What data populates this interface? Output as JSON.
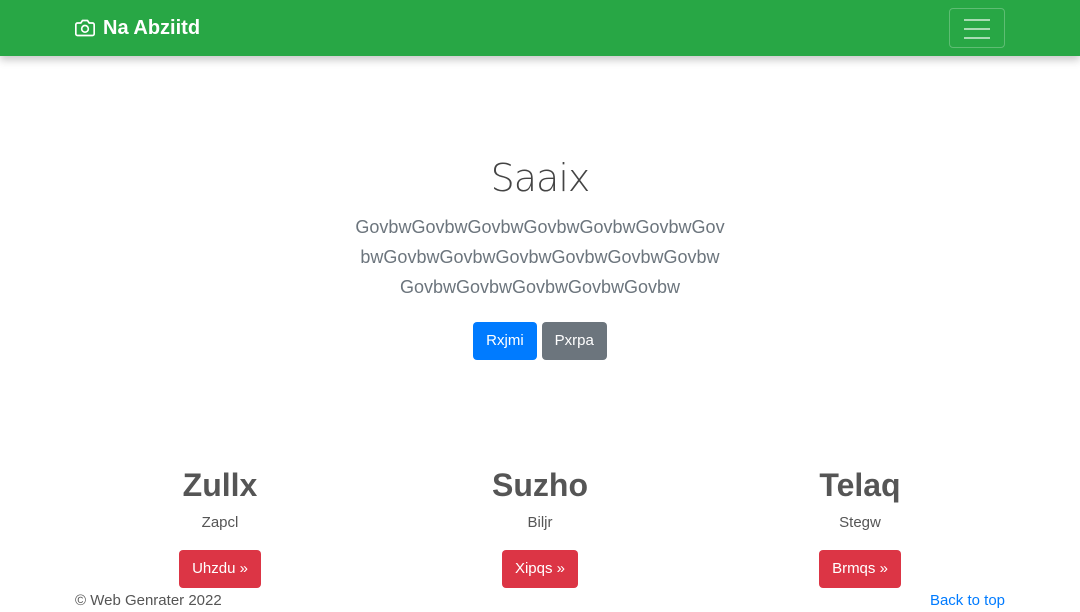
{
  "navbar": {
    "brand": "Na Abziitd",
    "brand_icon": "camera-icon",
    "toggler_icon": "hamburger-menu-icon",
    "background": "#28a745"
  },
  "hero": {
    "title": "Saaix",
    "lead": "GovbwGovbwGovbwGovbwGovbwGovbwGovbwGovbwGovbwGovbwGovbwGovbwGovbwGovbwGovbwGovbwGovbwGovbw",
    "primary_button": "Rxjmi",
    "secondary_button": "Pxrpa"
  },
  "features": [
    {
      "title": "Zullx",
      "text": "Zapcl",
      "button": "Uhzdu »"
    },
    {
      "title": "Suzho",
      "text": "Biljr",
      "button": "Xipqs »"
    },
    {
      "title": "Telaq",
      "text": "Stegw",
      "button": "Brmqs »"
    }
  ],
  "footer": {
    "copyright": "© Web Genrater 2022",
    "back_to_top": "Back to top"
  },
  "colors": {
    "primary": "#007bff",
    "secondary": "#6c757d",
    "danger": "#dc3545",
    "success": "#28a745"
  }
}
